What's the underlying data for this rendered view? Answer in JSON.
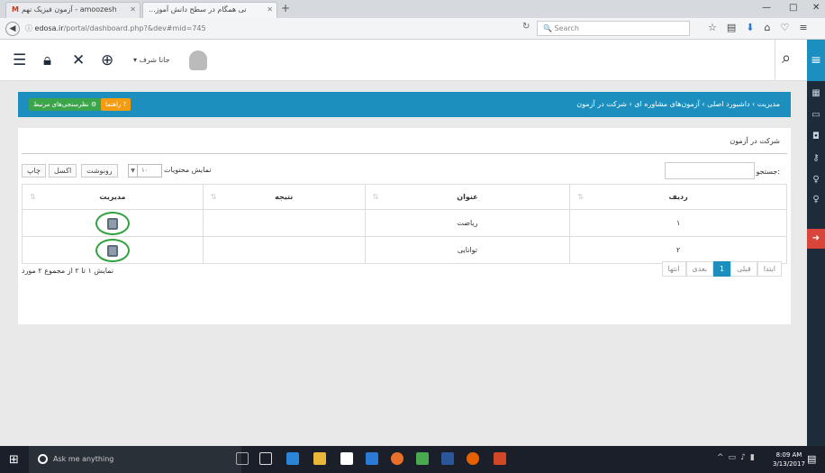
{
  "browser": {
    "tabs": [
      {
        "label": "آزمون فیزیک نهم - amoozesh",
        "icon": "gmail-icon"
      },
      {
        "label": "...نی همگام در سطح دانش آموز"
      }
    ],
    "url_host": "edosa.ir",
    "url_path": "/portal/dashboard.php?&dev#mid=745",
    "search_placeholder": "Search"
  },
  "header": {
    "user_name": "جانا شرف"
  },
  "breadcrumb": "مدیریت › داشبورد اصلی › آزمون‌های مشاوره ای › شرکت در آزمون",
  "actions": {
    "green_label": "نظرسنجی‌های مرتبط",
    "orange_label": "راهنما"
  },
  "panel": {
    "title": "شرکت در آزمون",
    "show_label": "نمایش محتویات",
    "page_size": "۱۰",
    "buttons": [
      "چاپ",
      "اکسل",
      "رونوشت"
    ],
    "search_label": "جستجو:"
  },
  "table": {
    "headers": [
      "ردیف",
      "عنوان",
      "نتیجه",
      "مدیریت"
    ],
    "rows": [
      {
        "index": "۱",
        "title": "ریاضت",
        "result": ""
      },
      {
        "index": "۲",
        "title": "توانایی",
        "result": ""
      }
    ]
  },
  "footer": {
    "info": "نمایش ۱ تا ۲ از مجموع ۲ مورد",
    "pager": [
      "ابتدا",
      "قبلی",
      "1",
      "بعدی",
      "انتها"
    ]
  },
  "taskbar": {
    "cortana_placeholder": "Ask me anything",
    "time": "8:09 AM",
    "date": "3/13/2017"
  }
}
